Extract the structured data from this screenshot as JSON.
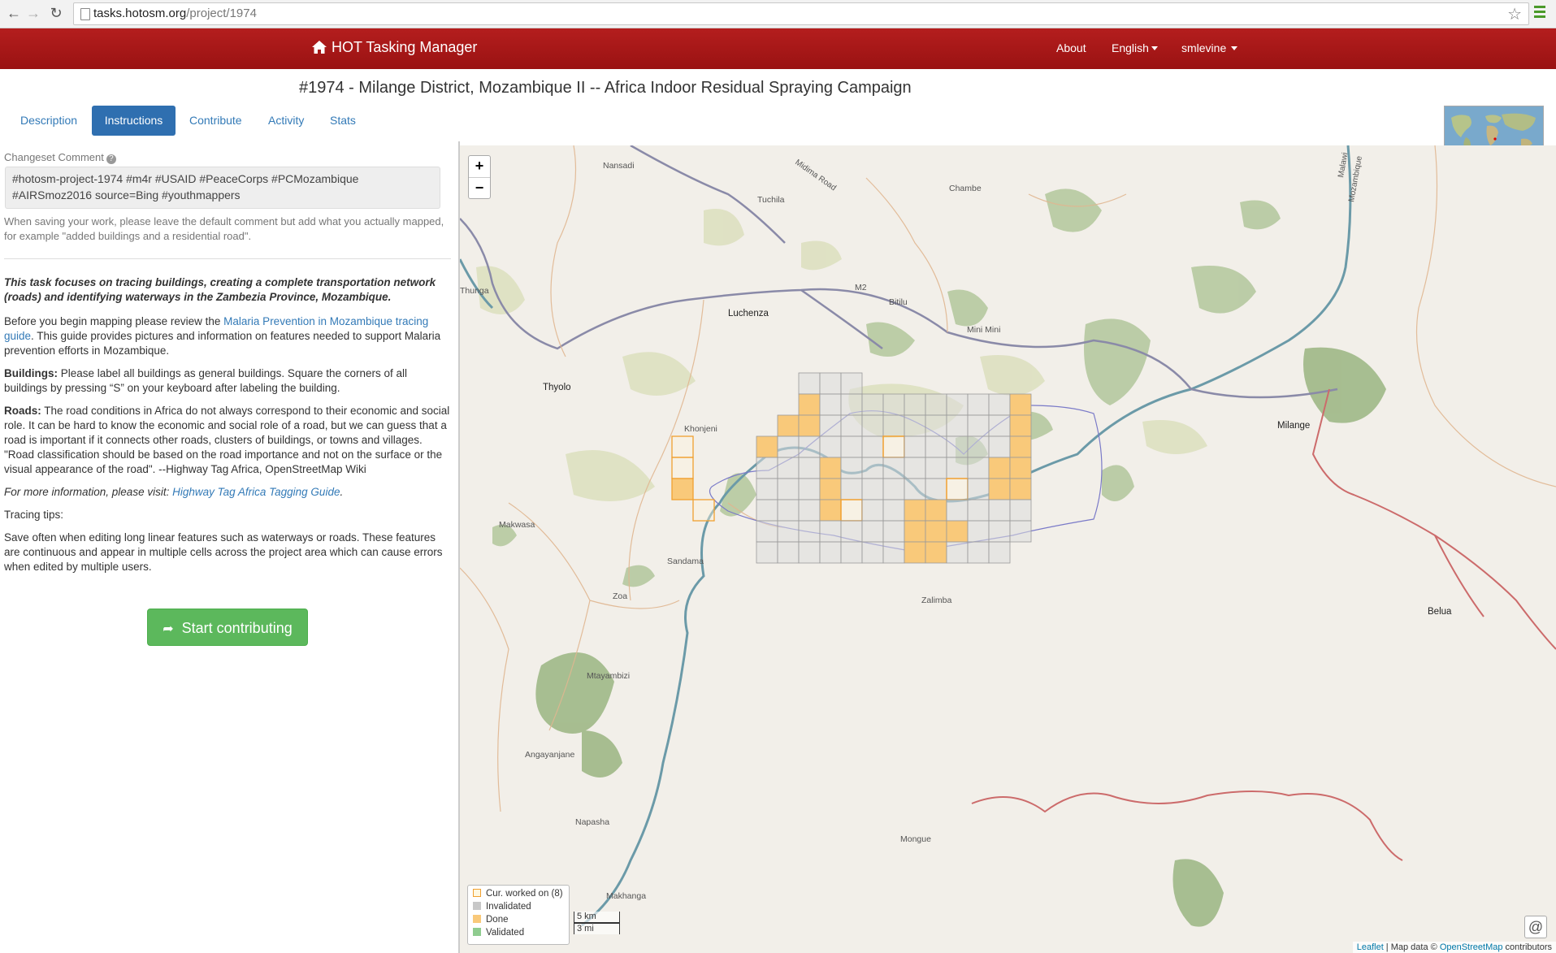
{
  "browser": {
    "url_host": "tasks.hotosm.org",
    "url_path": "/project/1974"
  },
  "navbar": {
    "brand": "HOT Tasking Manager",
    "about": "About",
    "language": "English",
    "user": "smlevine"
  },
  "page_title": "#1974 - Milange District, Mozambique II -- Africa Indoor Residual Spraying Campaign",
  "tabs": [
    "Description",
    "Instructions",
    "Contribute",
    "Activity",
    "Stats"
  ],
  "active_tab": "Instructions",
  "sidebar": {
    "changeset_label": "Changeset Comment",
    "changeset_line1": "#hotosm-project-1974 #m4r #USAID #PeaceCorps #PCMozambique",
    "changeset_line2": "#AIRSmoz2016 source=Bing #youthmappers",
    "help": "When saving your work, please leave the default comment but add what you actually mapped, for example \"added buildings and a residential road\".",
    "intro": "This task focuses on tracing buildings, creating a complete transportation network (roads) and identifying waterways in the Zambezia Province, Mozambique.",
    "p1_before": "Before you begin mapping please review the ",
    "p1_link": "Malaria Prevention in Mozambique tracing guide",
    "p1_after": ". This guide provides pictures and information on features needed to support Malaria prevention efforts in Mozambique.",
    "buildings_label": "Buildings:",
    "buildings_text": " Please label all buildings as general buildings. Square the corners of all buildings by pressing “S” on your keyboard after labeling the building.",
    "roads_label": "Roads:",
    "roads_text": " The road conditions in Africa do not always correspond to their economic and social role. It can be hard to know the economic and social role of a road, but we can guess that a road is important if it connects other roads, clusters of buildings, or towns and villages. \"Road classification should be based on the road importance and not on the surface or the visual appearance of the road\". --Highway Tag Africa, OpenStreetMap Wiki",
    "more_info": "For more information, please visit: ",
    "more_info_link": "Highway Tag Africa Tagging Guide",
    "more_info_end": ".",
    "tips_title": "Tracing tips:",
    "tips_text": "Save often when editing long linear features such as waterways or roads. These features are continuous and appear in multiple cells across the project area which can cause errors when edited by multiple users.",
    "start_button": "Start contributing"
  },
  "map": {
    "zoom_in": "+",
    "zoom_out": "−",
    "legend": [
      {
        "label": "Cur. worked on (8)",
        "color": "#fff8e0",
        "border": "#f0a030"
      },
      {
        "label": "Invalidated",
        "color": "#c8c8c8",
        "border": "#c8c8c8"
      },
      {
        "label": "Done",
        "color": "#f9c97a",
        "border": "#f9c97a"
      },
      {
        "label": "Validated",
        "color": "#8fcc8f",
        "border": "#8fcc8f"
      }
    ],
    "scale_km": "5 km",
    "scale_mi": "3 mi",
    "attribution_leaflet": "Leaflet",
    "attribution_mid": " | Map data © ",
    "attribution_osm": "OpenStreetMap",
    "attribution_end": " contributors",
    "places": [
      "Nansadi",
      "Chambe",
      "Tuchila",
      "Midima Road",
      "Thunga",
      "Luchenza",
      "M2",
      "Bitilu",
      "Thyolo",
      "Khonjeni",
      "Milange",
      "Malawi",
      "Mozambique",
      "Makwasa",
      "Sandama",
      "Zoa",
      "Zalimba",
      "Mtayambizi",
      "Angayanjane",
      "Napasha",
      "Mongue",
      "Belua",
      "Makhanga",
      "Mini Mini"
    ]
  },
  "colors": {
    "navbar": "#a81818",
    "done": "#f9c97a",
    "current": "#f0a030",
    "grid": "#9a9a9a",
    "water": "#6b9aa8",
    "road": "#8a8aa8",
    "road_red": "#cc6b6b",
    "forest": "#a8c08c"
  }
}
